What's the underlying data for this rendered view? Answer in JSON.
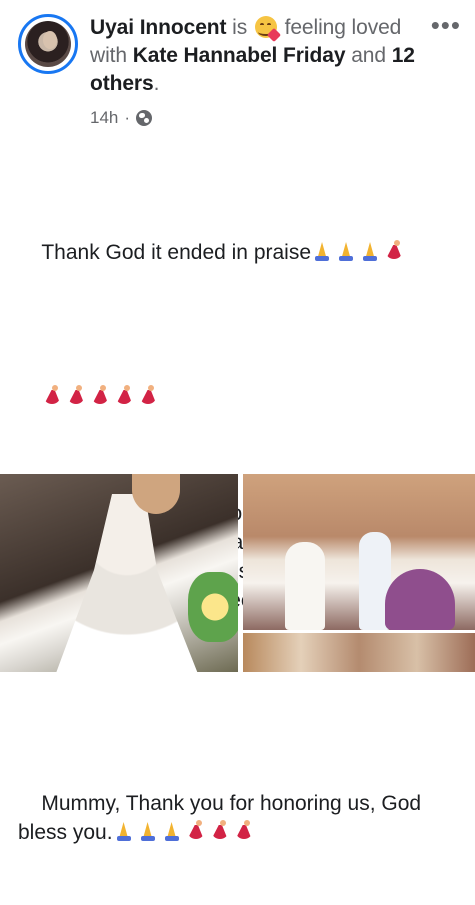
{
  "header": {
    "author": "Uyai Innocent",
    "is": "is",
    "feeling_prefix": "feeling",
    "feeling_text": "loved with",
    "tagged_person": "Kate Hannabel Friday",
    "and": "and",
    "others": "12 others",
    "period": ".",
    "time": "14h",
    "privacy_icon": "globe-icon",
    "more_label": "•••"
  },
  "post": {
    "line1": "Thank God it ended in praise",
    "paragraph1": "Our deepest appreciation to Her Excellency, the wife of the Governor, Pastor Mrs Patience Umo Eno that was ably represented by wives of five LGA transition committee chairmen.",
    "paragraph2": "Mummy, Thank you for honoring us, God bless you.",
    "icons": {
      "praying_hands": "praying-hands-icon",
      "dancer": "dancer-icon",
      "feeling_emoji": "smiling-face-with-hearts-icon"
    }
  },
  "colors": {
    "text": "#1c1e21",
    "muted": "#65676b",
    "avatar_ring": "#1877f2"
  }
}
